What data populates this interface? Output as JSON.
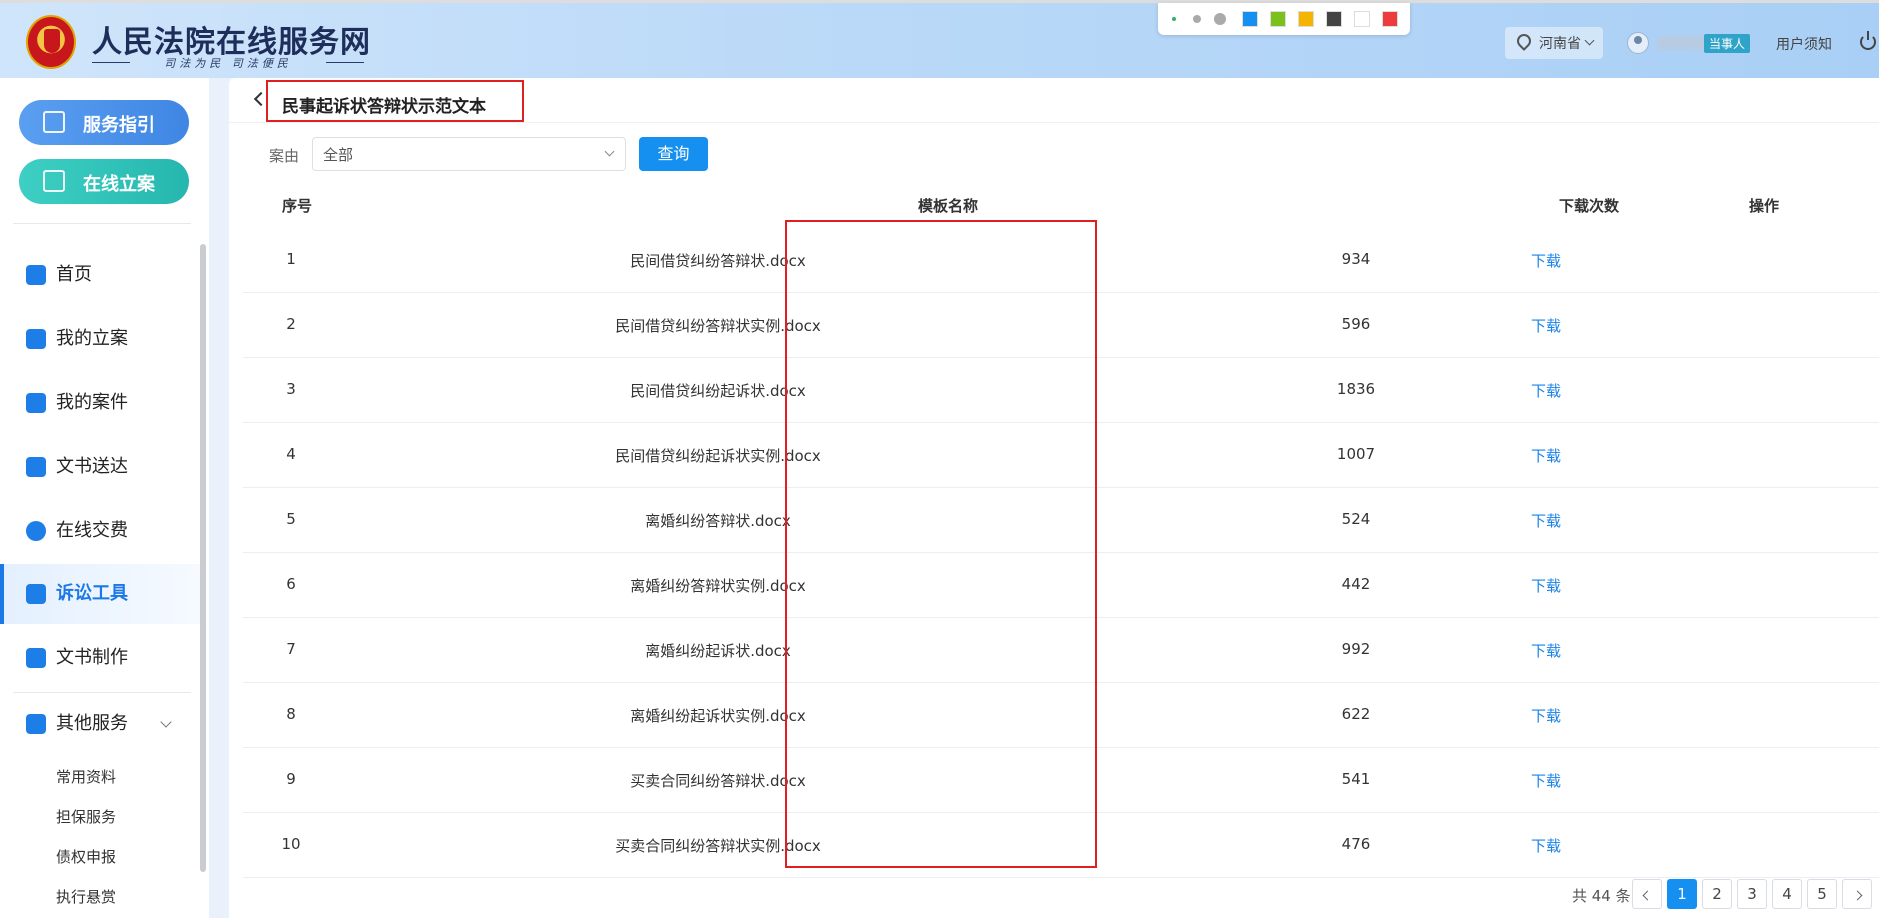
{
  "header": {
    "site_title": "人民法院在线服务网",
    "site_slogan": "司法为民 司法便民",
    "region": "河南省",
    "role_badge": "当事人",
    "user_notice": "用户须知",
    "toolbar_colors": [
      "#1590f0",
      "#7cc01e",
      "#f5b400",
      "#444444",
      "#ffffff",
      "#ee3b3b"
    ]
  },
  "sidebar": {
    "primary_buttons": [
      "服务指引",
      "在线立案"
    ],
    "items": [
      "首页",
      "我的立案",
      "我的案件",
      "文书送达",
      "在线交费",
      "诉讼工具",
      "文书制作",
      "其他服务"
    ],
    "active_item": "诉讼工具",
    "sub_items": [
      "常用资料",
      "担保服务",
      "债权申报",
      "执行悬赏"
    ]
  },
  "main": {
    "title": "民事起诉状答辩状示范文本",
    "filter": {
      "label": "案由",
      "selected": "全部",
      "query_button": "查询"
    },
    "table": {
      "headers": [
        "序号",
        "模板名称",
        "下载次数",
        "操作"
      ],
      "rows": [
        {
          "idx": "1",
          "name": "民间借贷纠纷答辩状.docx",
          "count": "934",
          "action": "下载"
        },
        {
          "idx": "2",
          "name": "民间借贷纠纷答辩状实例.docx",
          "count": "596",
          "action": "下载"
        },
        {
          "idx": "3",
          "name": "民间借贷纠纷起诉状.docx",
          "count": "1836",
          "action": "下载"
        },
        {
          "idx": "4",
          "name": "民间借贷纠纷起诉状实例.docx",
          "count": "1007",
          "action": "下载"
        },
        {
          "idx": "5",
          "name": "离婚纠纷答辩状.docx",
          "count": "524",
          "action": "下载"
        },
        {
          "idx": "6",
          "name": "离婚纠纷答辩状实例.docx",
          "count": "442",
          "action": "下载"
        },
        {
          "idx": "7",
          "name": "离婚纠纷起诉状.docx",
          "count": "992",
          "action": "下载"
        },
        {
          "idx": "8",
          "name": "离婚纠纷起诉状实例.docx",
          "count": "622",
          "action": "下载"
        },
        {
          "idx": "9",
          "name": "买卖合同纠纷答辩状.docx",
          "count": "541",
          "action": "下载"
        },
        {
          "idx": "10",
          "name": "买卖合同纠纷答辩状实例.docx",
          "count": "476",
          "action": "下载"
        }
      ]
    },
    "pagination": {
      "total_text": "共 44 条",
      "pages": [
        "1",
        "2",
        "3",
        "4",
        "5"
      ],
      "current": "1"
    }
  }
}
